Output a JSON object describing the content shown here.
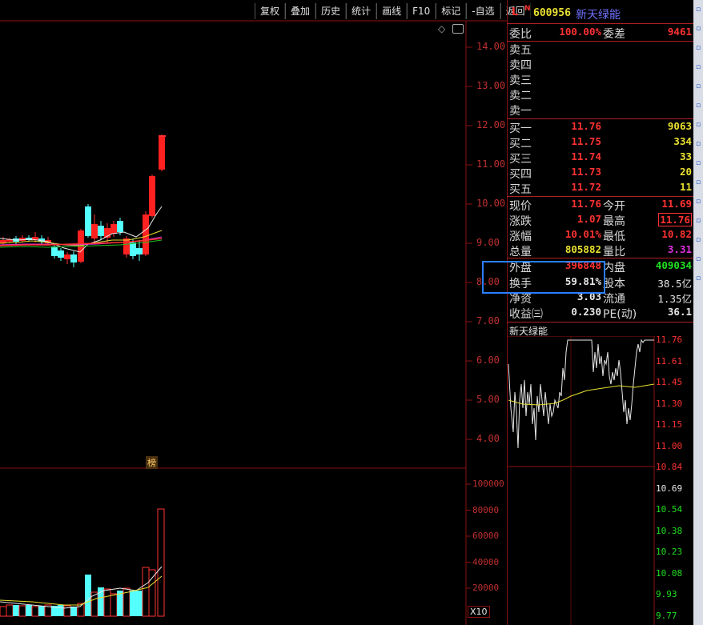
{
  "toolbar": {
    "items": [
      "复权",
      "叠加",
      "历史",
      "统计",
      "画线",
      "F10",
      "标记",
      "-自选",
      "返回"
    ]
  },
  "kline": {
    "price_axis": [
      "14.00",
      "13.00",
      "12.00",
      "11.00",
      "10.00",
      "9.00",
      "8.00",
      "7.00",
      "6.00",
      "5.00",
      "4.00"
    ],
    "volume_axis": [
      "100000",
      "80000",
      "60000",
      "40000",
      "20000"
    ],
    "volume_unit": "X10",
    "badge": "榜",
    "diamond_icon": "◇"
  },
  "stock": {
    "flag_l": "L",
    "flag_n": "N",
    "code": "600956",
    "name": "新天绿能"
  },
  "orderbook": {
    "wei_bi_label": "委比",
    "wei_bi": "100.00%",
    "wei_cha_label": "委差",
    "wei_cha": "9461",
    "sell": [
      {
        "label": "卖五",
        "price": "",
        "qty": ""
      },
      {
        "label": "卖四",
        "price": "",
        "qty": ""
      },
      {
        "label": "卖三",
        "price": "",
        "qty": ""
      },
      {
        "label": "卖二",
        "price": "",
        "qty": ""
      },
      {
        "label": "卖一",
        "price": "",
        "qty": ""
      }
    ],
    "buy": [
      {
        "label": "买一",
        "price": "11.76",
        "qty": "9063"
      },
      {
        "label": "买二",
        "price": "11.75",
        "qty": "334"
      },
      {
        "label": "买三",
        "price": "11.74",
        "qty": "33"
      },
      {
        "label": "买四",
        "price": "11.73",
        "qty": "20"
      },
      {
        "label": "买五",
        "price": "11.72",
        "qty": "11"
      }
    ]
  },
  "quote": {
    "xianjia_label": "现价",
    "xianjia": "11.76",
    "jinkai_label": "今开",
    "jinkai": "11.69",
    "zhangdie_label": "涨跌",
    "zhangdie": "1.07",
    "zuigao_label": "最高",
    "zuigao": "11.76",
    "zhangfu_label": "涨幅",
    "zhangfu": "10.01%",
    "zuidi_label": "最低",
    "zuidi": "10.82",
    "zongliang_label": "总量",
    "zongliang": "805882",
    "liangbi_label": "量比",
    "liangbi": "3.31",
    "waipan_label": "外盘",
    "waipan": "396848",
    "neipan_label": "内盘",
    "neipan": "409034",
    "huanshou_label": "换手",
    "huanshou": "59.81%",
    "guben_label": "股本",
    "guben": "38.5亿",
    "jingzi_label": "净资",
    "jingzi": "3.03",
    "liutong_label": "流通",
    "liutong": "1.35亿",
    "shouyi_label": "收益㈢",
    "shouyi": "0.230",
    "pe_label": "PE(动)",
    "pe": "36.1"
  },
  "intraday": {
    "title": "新天绿能",
    "prices": [
      "11.76",
      "11.61",
      "11.45",
      "11.30",
      "11.15",
      "11.00",
      "10.84",
      "10.69",
      "10.54",
      "10.38",
      "10.23",
      "10.08",
      "9.93",
      "9.77"
    ]
  },
  "colors": {
    "up": "#ff3232",
    "down": "#54ffff",
    "highlight_box": "#2a7fff",
    "grid": "#8b1010"
  }
}
